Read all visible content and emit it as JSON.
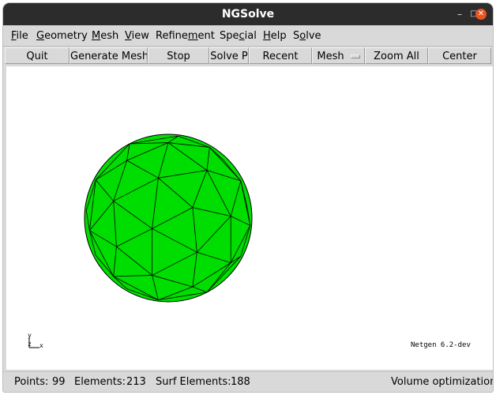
{
  "window": {
    "title": "NGSolve",
    "controls": [
      "minimize",
      "maximize",
      "close"
    ]
  },
  "menubar": {
    "items": [
      {
        "label": "File"
      },
      {
        "label": "Geometry"
      },
      {
        "label": "Mesh"
      },
      {
        "label": "View"
      },
      {
        "label": "Refinement"
      },
      {
        "label": "Special"
      },
      {
        "label": "Help"
      },
      {
        "label": "Solve"
      }
    ]
  },
  "toolbar": {
    "quit": "Quit",
    "generate_mesh": "Generate Mesh",
    "stop": "Stop",
    "solve": "Solve P",
    "recent": "Recent",
    "view_mode": "Mesh",
    "zoom_all": "Zoom All",
    "center": "Center"
  },
  "viewport": {
    "mesh_color": "#00dd00",
    "edge_color": "#000000",
    "axis_x_label": "x",
    "axis_y_label": "y",
    "axis_z_label": "z",
    "version_label": "Netgen 6.2-dev"
  },
  "status": {
    "points_label": "Points:",
    "points_value": "99",
    "elements_label": "Elements:",
    "elements_value": "213",
    "surf_label": "Surf Elements:",
    "surf_value": "188",
    "task": "Volume optimization"
  }
}
